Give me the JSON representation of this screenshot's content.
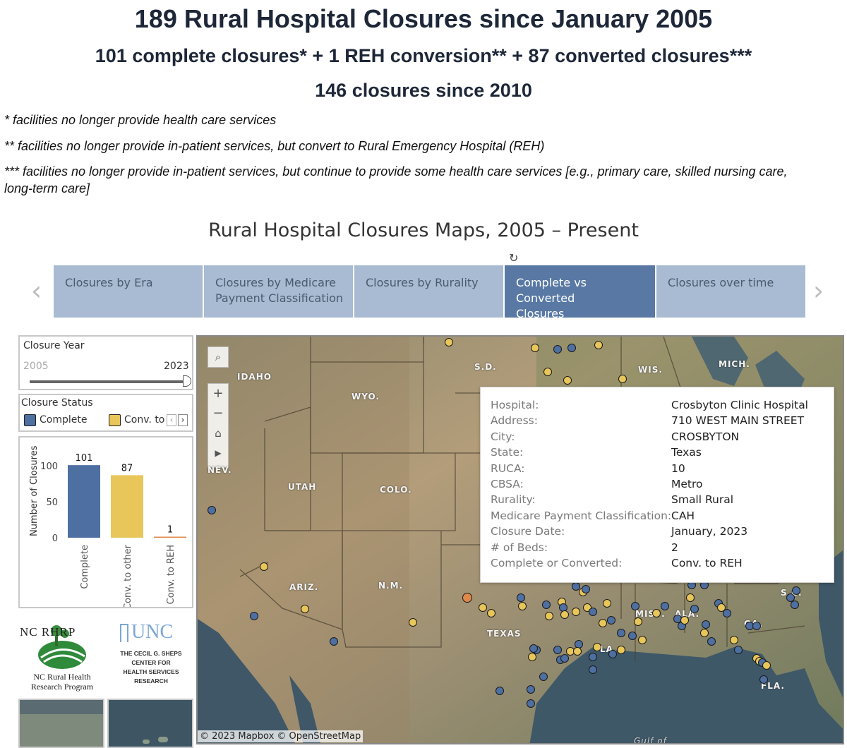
{
  "header": {
    "title": "189 Rural Hospital Closures since January 2005",
    "subtitle": "101 complete closures* + 1 REH conversion** + 87 converted closures***",
    "since": "146 closures since 2010",
    "notes": [
      "* facilities no longer provide health care services",
      "** facilities no longer provide in-patient services, but convert to Rural Emergency Hospital (REH)",
      "*** facilities no longer provide in-patient services, but continue to provide some health care services [e.g., primary care, skilled nursing care,",
      "long-term care]"
    ]
  },
  "dashboard": {
    "title": "Rural Hospital Closures Maps, 2005 – Present",
    "tabs": [
      {
        "label_1": "Closures by Era",
        "label_2": ""
      },
      {
        "label_1": "Closures by Medicare",
        "label_2": "Payment Classification"
      },
      {
        "label_1": "Closures by Rurality",
        "label_2": ""
      },
      {
        "label_1": "Complete vs Converted",
        "label_2": "Closures"
      },
      {
        "label_1": "Closures over time",
        "label_2": ""
      }
    ],
    "active_tab": 3
  },
  "filters": {
    "year_label": "Closure Year",
    "year_min": "2005",
    "year_max": "2023",
    "status_label": "Closure Status",
    "legend": [
      {
        "label": "Complete",
        "color": "#4e6fa1"
      },
      {
        "label": "Conv. to",
        "color": "#e8c65a"
      }
    ]
  },
  "chart_data": {
    "type": "bar",
    "categories": [
      "Complete",
      "Conv. to other",
      "Conv. to REH"
    ],
    "values": [
      101,
      87,
      1
    ],
    "value_labels": [
      "101",
      "87",
      "1"
    ],
    "colors": [
      "#4e6fa1",
      "#e8c65a",
      "#e0884a"
    ],
    "ylabel": "Number of Closures",
    "yticks": [
      "100",
      "50",
      "0"
    ],
    "ylim": [
      0,
      110
    ]
  },
  "logos": {
    "ncrhrp_title": "NC RHRP",
    "ncrhrp_line1": "NC Rural Health",
    "ncrhrp_line2": "Research Program",
    "unc_title": "UNC",
    "unc_line1": "THE CECIL G. SHEPS",
    "unc_line2": "CENTER FOR",
    "unc_line3": "HEALTH SERVICES",
    "unc_line4": "RESEARCH"
  },
  "map": {
    "state_labels": [
      "IDAHO",
      "WYO.",
      "S.D.",
      "WIS.",
      "MICH.",
      "NEV.",
      "UTAH",
      "COLO.",
      "ARIZ.",
      "N.M.",
      "TEXAS",
      "LA.",
      "MISS.",
      "ALA.",
      "GA.",
      "S.C.",
      "FLA.",
      "Gulf of"
    ],
    "copyright": "© 2023 Mapbox  © OpenStreetMap",
    "colors": {
      "complete": "#4e6fa1",
      "converted": "#e8c65a",
      "reh": "#e0884a"
    }
  },
  "tooltip": {
    "rows": [
      {
        "key": "Hospital:",
        "value": "Crosbyton Clinic Hospital"
      },
      {
        "key": "Address:",
        "value": "710 WEST MAIN STREET"
      },
      {
        "key": "City:",
        "value": "CROSBYTON"
      },
      {
        "key": "State:",
        "value": "Texas"
      },
      {
        "key": "RUCA:",
        "value": "10"
      },
      {
        "key": "CBSA:",
        "value": "Metro"
      },
      {
        "key": "Rurality:",
        "value": "Small Rural"
      },
      {
        "key": "Medicare Payment Classification:",
        "value": "CAH"
      },
      {
        "key": "Closure Date:",
        "value": "January, 2023"
      },
      {
        "key": "# of Beds:",
        "value": "2"
      },
      {
        "key": "Complete or Converted:",
        "value": "Conv. to REH"
      }
    ]
  }
}
